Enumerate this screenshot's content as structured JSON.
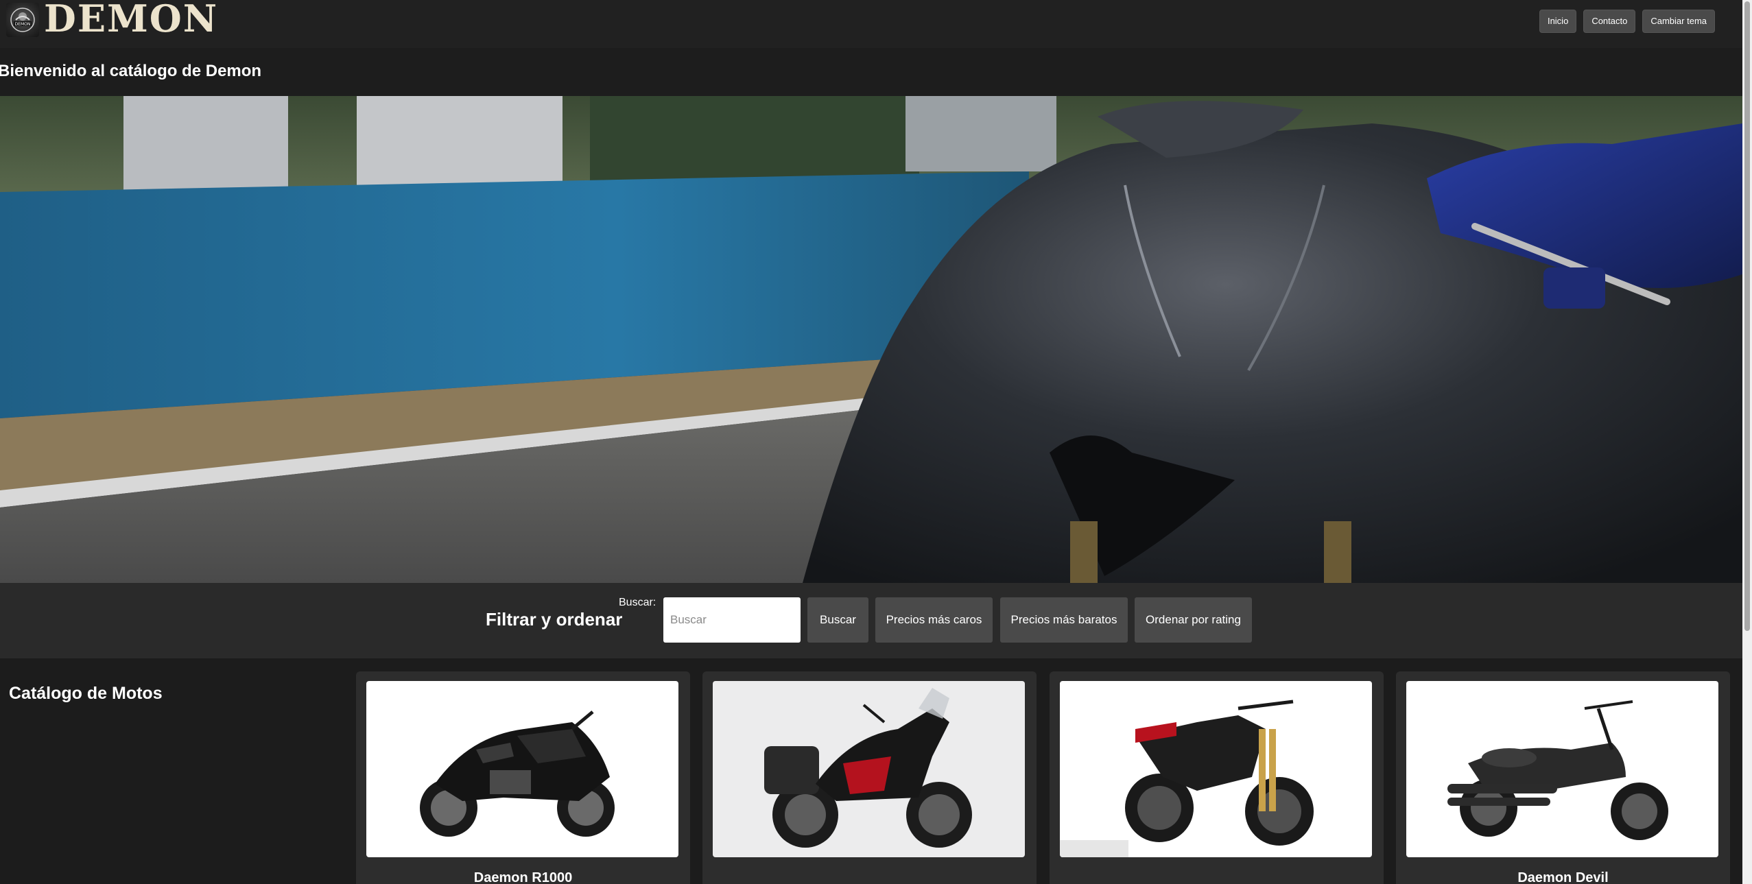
{
  "header": {
    "brand": "DEMON",
    "logo_text": "DEMON",
    "nav": [
      "Inicio",
      "Contacto",
      "Cambiar tema"
    ]
  },
  "welcome": {
    "title": "Bienvenido al catálogo de Demon"
  },
  "filter": {
    "title": "Filtrar y ordenar",
    "search_label": "Buscar:",
    "search_placeholder": "Buscar",
    "search_value": "",
    "buttons": [
      "Buscar",
      "Precios más caros",
      "Precios más baratos",
      "Ordenar por rating"
    ]
  },
  "catalog": {
    "title": "Catálogo de Motos",
    "items": [
      {
        "name": "Daemon R1000"
      },
      {
        "name": ""
      },
      {
        "name": ""
      },
      {
        "name": "Daemon Devil"
      }
    ]
  },
  "colors": {
    "header_bg": "#212121",
    "brand_color": "#ece3cc",
    "button_bg": "#4a4a4a",
    "card_bg": "#2d2d2d"
  },
  "icons": {
    "logo": "demon-logo-icon"
  }
}
